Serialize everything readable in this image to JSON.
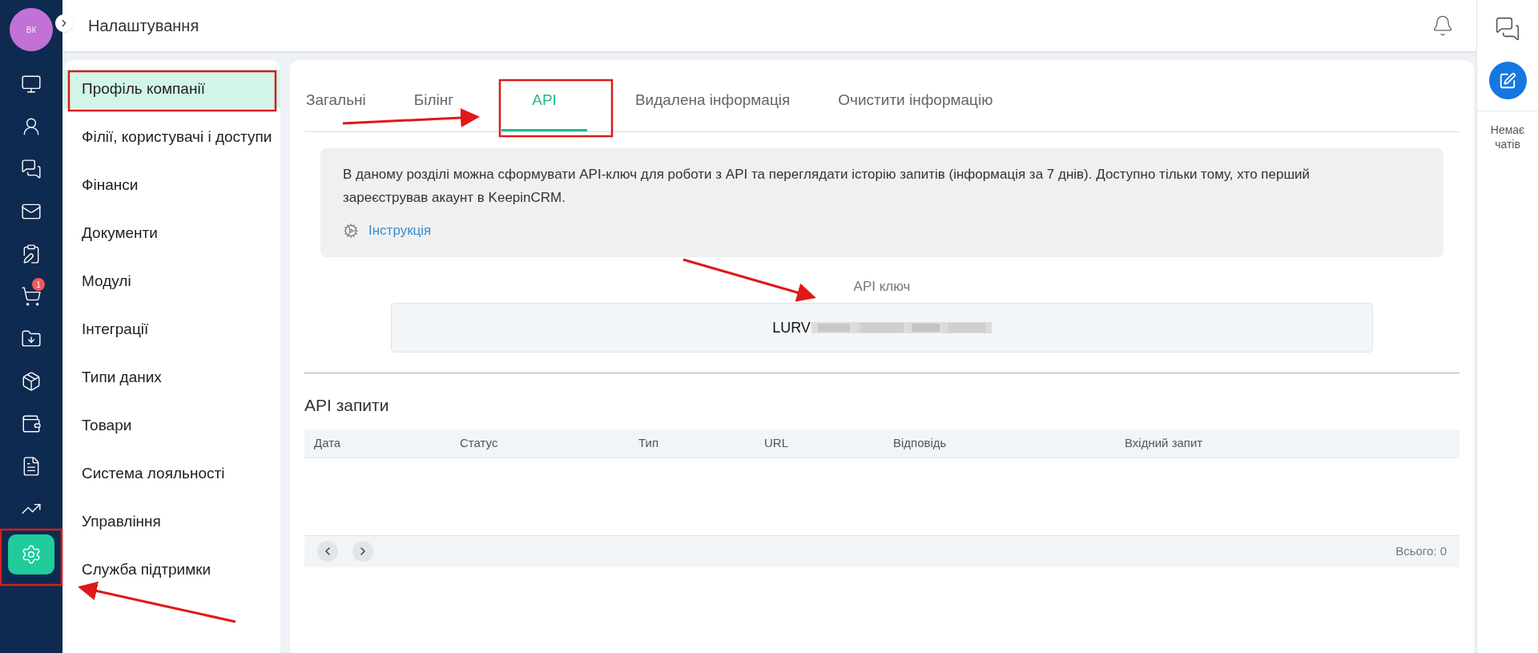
{
  "user": {
    "initials": "ВК"
  },
  "nav_items": [
    {
      "selected": false
    },
    {
      "selected": false
    },
    {
      "selected": false
    },
    {
      "selected": false
    },
    {
      "selected": false
    },
    {
      "selected": false,
      "badge": "1"
    },
    {
      "selected": false
    },
    {
      "selected": false
    },
    {
      "selected": false
    },
    {
      "selected": false
    },
    {
      "selected": false
    },
    {
      "selected": true
    }
  ],
  "header": {
    "title": "Налаштування"
  },
  "settings_menu": [
    {
      "label": "Профіль компанії",
      "selected": true
    },
    {
      "label": "Філії, користувачі і доступи",
      "selected": false
    },
    {
      "label": "Фінанси",
      "selected": false
    },
    {
      "label": "Документи",
      "selected": false
    },
    {
      "label": "Модулі",
      "selected": false
    },
    {
      "label": "Інтеграції",
      "selected": false
    },
    {
      "label": "Типи даних",
      "selected": false
    },
    {
      "label": "Товари",
      "selected": false
    },
    {
      "label": "Система лояльності",
      "selected": false
    },
    {
      "label": "Управління",
      "selected": false
    },
    {
      "label": "Служба підтримки",
      "selected": false
    }
  ],
  "tabs": [
    {
      "label": "Загальні",
      "selected": false
    },
    {
      "label": "Білінг",
      "selected": false
    },
    {
      "label": "API",
      "selected": true
    },
    {
      "label": "Видалена інформація",
      "selected": false
    },
    {
      "label": "Очистити інформацію",
      "selected": false
    }
  ],
  "info": {
    "text": "В даному розділі можна сформувати API-ключ для роботи з API та переглядати історію запитів (інформація за 7 днів). Доступно тільки тому, хто перший зареєстрував акаунт в KeepinCRM.",
    "link": "Інструкція"
  },
  "api_key": {
    "label": "API ключ",
    "value": "LURV"
  },
  "requests": {
    "title": "API запити",
    "columns": [
      "Дата",
      "Статус",
      "Тип",
      "URL",
      "Відповідь",
      "Вхідний запит"
    ],
    "total": "Всього: 0"
  },
  "chat_panel": {
    "empty": "Немає чатів"
  }
}
